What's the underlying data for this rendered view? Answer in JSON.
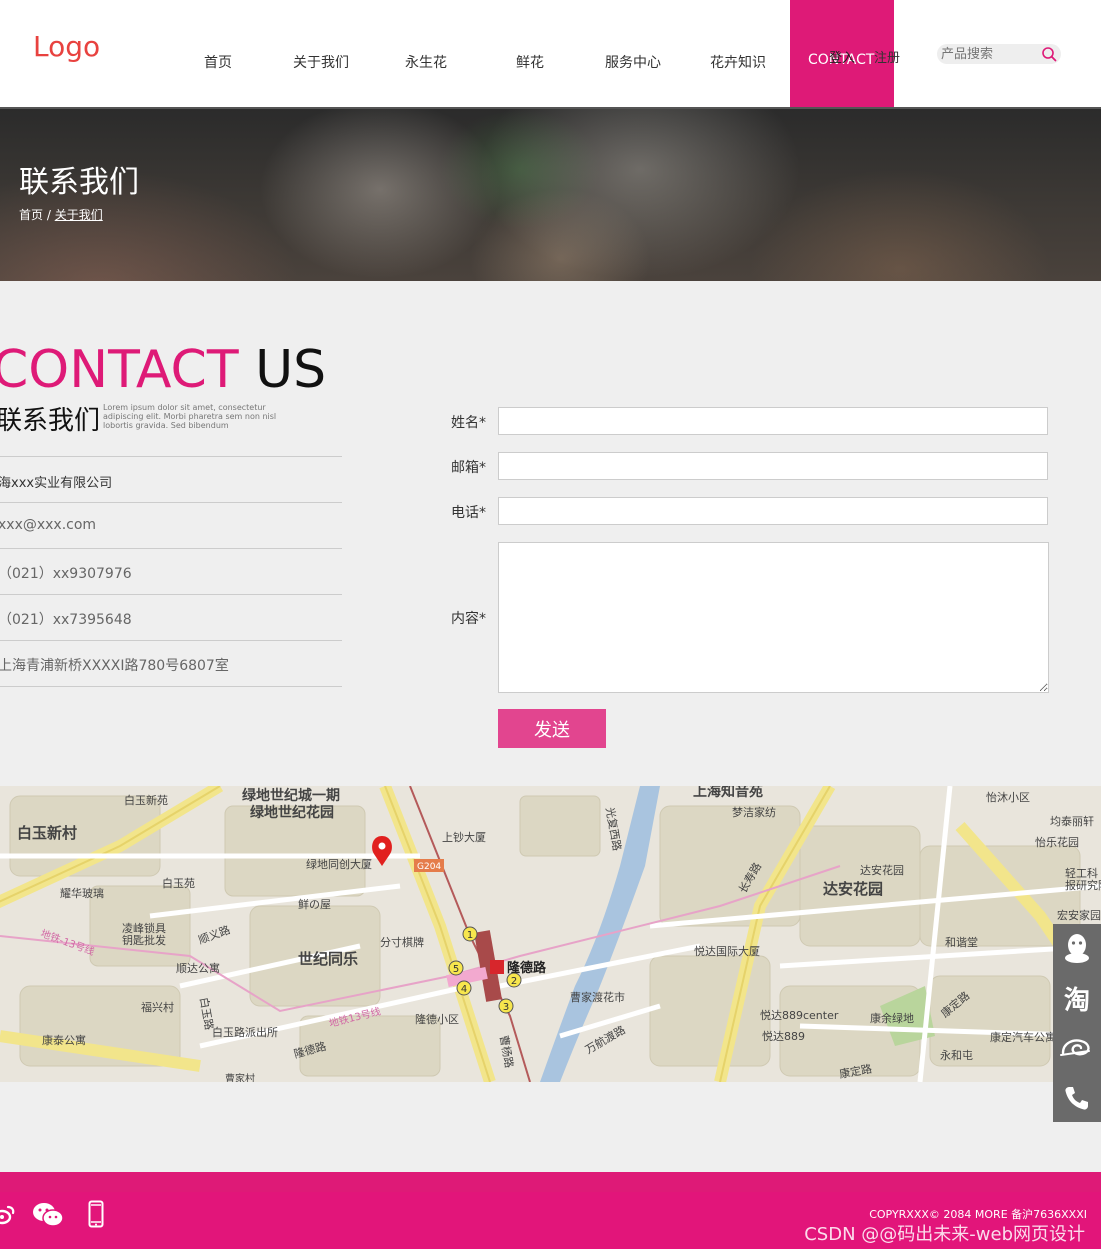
{
  "header": {
    "logo": "Logo",
    "nav": [
      "首页",
      "关于我们",
      "永生花",
      "鲜花",
      "服务中心",
      "花卉知识"
    ],
    "active_nav": "CONTACT",
    "login": "登入",
    "register": "注册",
    "search_placeholder": "产品搜索"
  },
  "banner": {
    "title": "联系我们",
    "breadcrumb_home": "首页",
    "breadcrumb_sep": "/",
    "breadcrumb_current": "关于我们"
  },
  "contact": {
    "heading_a": "CONTACT",
    "heading_b": " US",
    "subheading": "联系我们",
    "lorem": "Lorem ipsum dolor sit amet, consectetur adipiscing elit. Morbi pharetra sem non nisl lobortis gravida. Sed bibendum",
    "company": "海xxx实业有限公司",
    "email": "xxx@xxx.com",
    "phone1": "（021）xx9307976",
    "phone2": "（021）xx7395648",
    "address": "上海青浦新桥XXXXI路780号6807室"
  },
  "form": {
    "name_label": "姓名*",
    "email_label": "邮箱*",
    "phone_label": "电话*",
    "content_label": "内容*",
    "submit": "发送"
  },
  "map": {
    "labels": [
      "白玉新苑",
      "绿地世纪城一期",
      "绿地世纪花园",
      "上钞大厦",
      "绿地同创大厦",
      "G204",
      "上海知音苑",
      "梦洁家纺",
      "怡沐小区",
      "均泰丽轩",
      "怡乐花园",
      "白玉新村",
      "耀华玻璃",
      "白玉苑",
      "鲜の屋",
      "达安花园",
      "轻工科",
      "报研究院",
      "凌峰锁具",
      "钥匙批发",
      "顺义路",
      "世纪同乐",
      "分寸棋牌",
      "隆德路",
      "悦达国际大厦",
      "宏安家园",
      "和谐堂",
      "顺达公寓",
      "福兴村",
      "白玉路",
      "白玉路派出所",
      "隆德小区",
      "曹家渡花市",
      "悦达889center",
      "悦达889",
      "康余绿地",
      "康定路",
      "康定汽车公寓",
      "康泰公寓",
      "隆德路",
      "曹杨路",
      "万航渡路",
      "永和屯",
      "地铁-13号线",
      "地铁13号线",
      "光复西路",
      "长寿路",
      "康定路",
      "曹家村"
    ],
    "metro_numbers": [
      "1",
      "2",
      "3",
      "4",
      "5"
    ]
  },
  "side_panel": {
    "taobao": "淘"
  },
  "footer": {
    "copyright": "COPYRXXX© 2084 MORE 备沪7636XXXI",
    "watermark": "CSDN @@码出未来-web网页设计"
  },
  "colors": {
    "accent": "#de1a77",
    "logo": "#e8423f",
    "button": "#e2458f",
    "side_panel": "#6a6a6a"
  }
}
